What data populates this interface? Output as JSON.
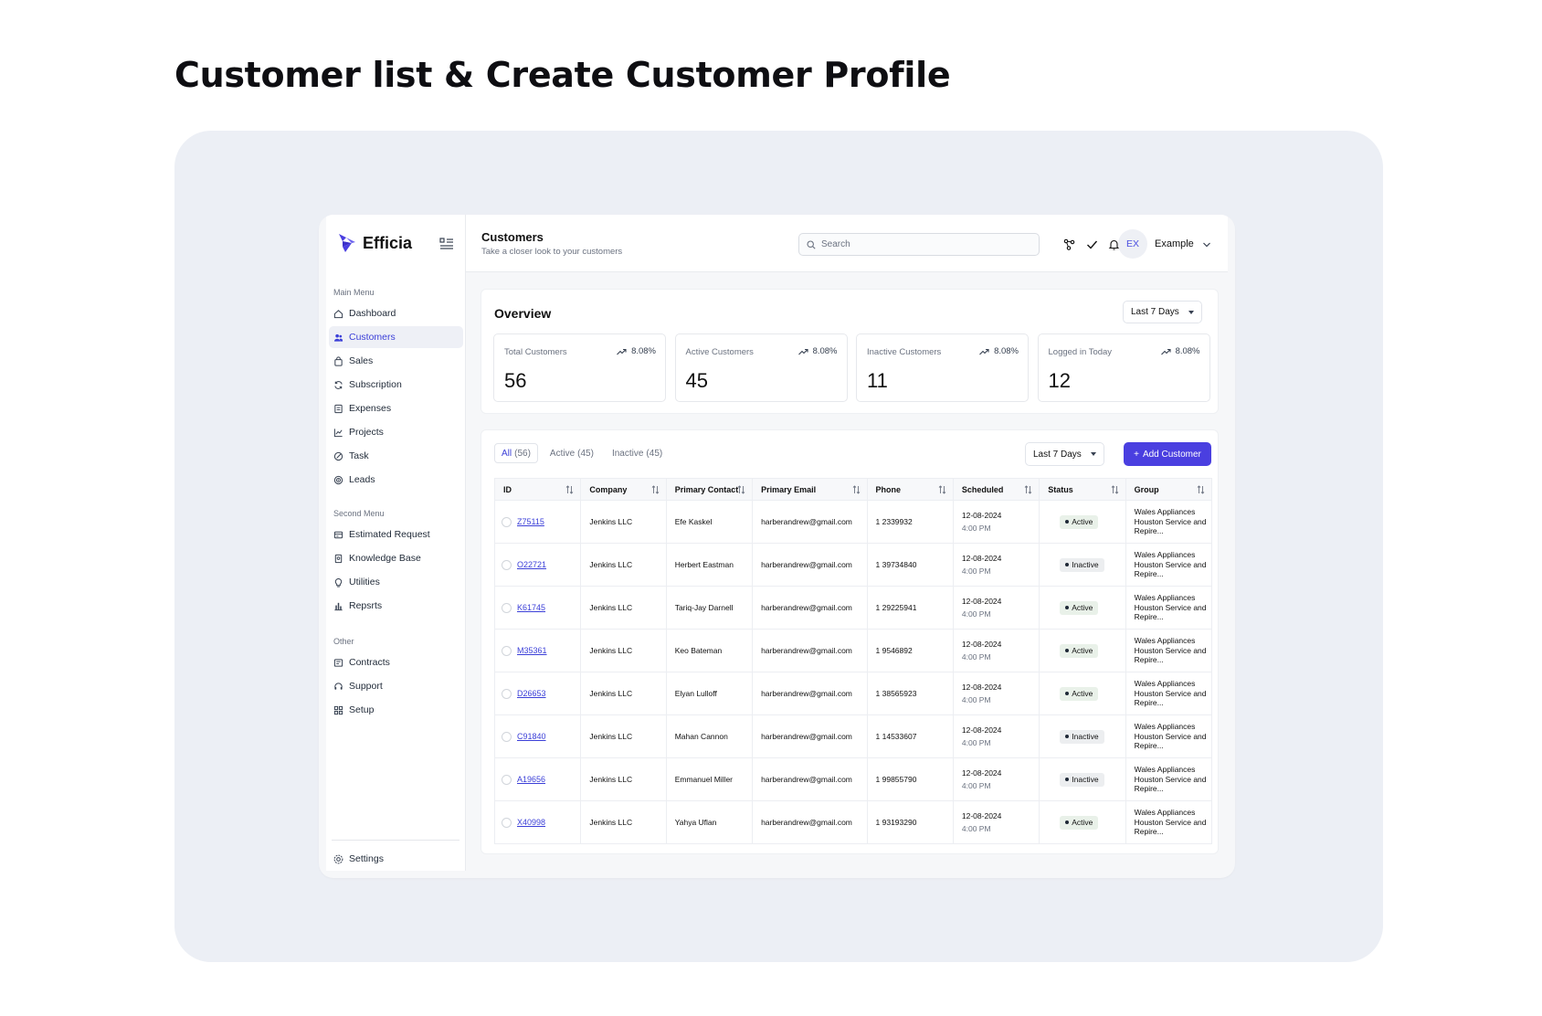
{
  "page_heading": "Customer list & Create Customer Profile",
  "brand": {
    "name": "Efficia"
  },
  "sidebar": {
    "main_caption": "Main Menu",
    "main_items": [
      {
        "label": "Dashboard",
        "icon": "home-icon"
      },
      {
        "label": "Customers",
        "icon": "users-icon",
        "active": true
      },
      {
        "label": "Sales",
        "icon": "bag-icon"
      },
      {
        "label": "Subscription",
        "icon": "refresh-icon"
      },
      {
        "label": "Expenses",
        "icon": "receipt-icon"
      },
      {
        "label": "Projects",
        "icon": "chart-line-icon"
      },
      {
        "label": "Task",
        "icon": "task-icon"
      },
      {
        "label": "Leads",
        "icon": "target-icon"
      }
    ],
    "second_caption": "Second Menu",
    "second_items": [
      {
        "label": "Estimated Request",
        "icon": "card-icon"
      },
      {
        "label": "Knowledge Base",
        "icon": "book-icon"
      },
      {
        "label": "Utilities",
        "icon": "lightbulb-icon"
      },
      {
        "label": "Repsrts",
        "icon": "bar-chart-icon"
      }
    ],
    "other_caption": "Other",
    "other_items": [
      {
        "label": "Contracts",
        "icon": "contract-icon"
      },
      {
        "label": "Support",
        "icon": "headset-icon"
      },
      {
        "label": "Setup",
        "icon": "grid-icon"
      }
    ],
    "settings_label": "Settings"
  },
  "topbar": {
    "title": "Customers",
    "subtitle": "Take a closer look to your customers",
    "search_placeholder": "Search",
    "avatar_initials": "EX",
    "user_name": "Example"
  },
  "overview": {
    "title": "Overview",
    "range": "Last 7 Days",
    "stats": [
      {
        "label": "Total Customers",
        "trend": "8.08%",
        "value": "56"
      },
      {
        "label": "Active Customers",
        "trend": "8.08%",
        "value": "45"
      },
      {
        "label": "Inactive Customers",
        "trend": "8.08%",
        "value": "11"
      },
      {
        "label": "Logged in Today",
        "trend": "8.08%",
        "value": "12"
      }
    ]
  },
  "customers": {
    "tabs": [
      {
        "label": "All",
        "count": "(56)",
        "active": true
      },
      {
        "label": "Active",
        "count": "(45)"
      },
      {
        "label": "Inactive",
        "count": "(45)"
      }
    ],
    "range": "Last 7 Days",
    "add_button": "Add Customer",
    "columns": [
      "ID",
      "Company",
      "Primary Contact",
      "Primary Email",
      "Phone",
      "Scheduled",
      "Status",
      "Group"
    ],
    "rows": [
      {
        "id": "Z75115",
        "company": "Jenkins LLC",
        "contact": "Efe Kaskel",
        "email": "harberandrew@gmail.com",
        "phone": "1 2339932",
        "date": "12-08-2024",
        "time": "4:00 PM",
        "status": "Active",
        "group": "Wales Appliances Houston Service and Repire..."
      },
      {
        "id": "O22721",
        "company": "Jenkins LLC",
        "contact": "Herbert Eastman",
        "email": "harberandrew@gmail.com",
        "phone": "1 39734840",
        "date": "12-08-2024",
        "time": "4:00 PM",
        "status": "Inactive",
        "group": "Wales Appliances Houston Service and Repire..."
      },
      {
        "id": "K61745",
        "company": "Jenkins LLC",
        "contact": "Tariq-Jay Darnell",
        "email": "harberandrew@gmail.com",
        "phone": "1 29225941",
        "date": "12-08-2024",
        "time": "4:00 PM",
        "status": "Active",
        "group": "Wales Appliances Houston Service and Repire..."
      },
      {
        "id": "M35361",
        "company": "Jenkins LLC",
        "contact": "Keo Bateman",
        "email": "harberandrew@gmail.com",
        "phone": "1 9546892",
        "date": "12-08-2024",
        "time": "4:00 PM",
        "status": "Active",
        "group": "Wales Appliances Houston Service and Repire..."
      },
      {
        "id": "D26653",
        "company": "Jenkins LLC",
        "contact": "Elyan Lulloff",
        "email": "harberandrew@gmail.com",
        "phone": "1 38565923",
        "date": "12-08-2024",
        "time": "4:00 PM",
        "status": "Active",
        "group": "Wales Appliances Houston Service and Repire..."
      },
      {
        "id": "C91840",
        "company": "Jenkins LLC",
        "contact": "Mahan Cannon",
        "email": "harberandrew@gmail.com",
        "phone": "1 14533607",
        "date": "12-08-2024",
        "time": "4:00 PM",
        "status": "Inactive",
        "group": "Wales Appliances Houston Service and Repire..."
      },
      {
        "id": "A19656",
        "company": "Jenkins LLC",
        "contact": "Emmanuel Miller",
        "email": "harberandrew@gmail.com",
        "phone": "1 99855790",
        "date": "12-08-2024",
        "time": "4:00 PM",
        "status": "Inactive",
        "group": "Wales Appliances Houston Service and Repire..."
      },
      {
        "id": "X40998",
        "company": "Jenkins LLC",
        "contact": "Yahya Uflan",
        "email": "harberandrew@gmail.com",
        "phone": "1 93193290",
        "date": "12-08-2024",
        "time": "4:00 PM",
        "status": "Active",
        "group": "Wales Appliances Houston Service and Repire..."
      }
    ]
  },
  "colors": {
    "accent": "#4a3fe0",
    "stage": "#eceff5",
    "active_badge": "#e9f1e9",
    "inactive_badge": "#eceef0"
  }
}
